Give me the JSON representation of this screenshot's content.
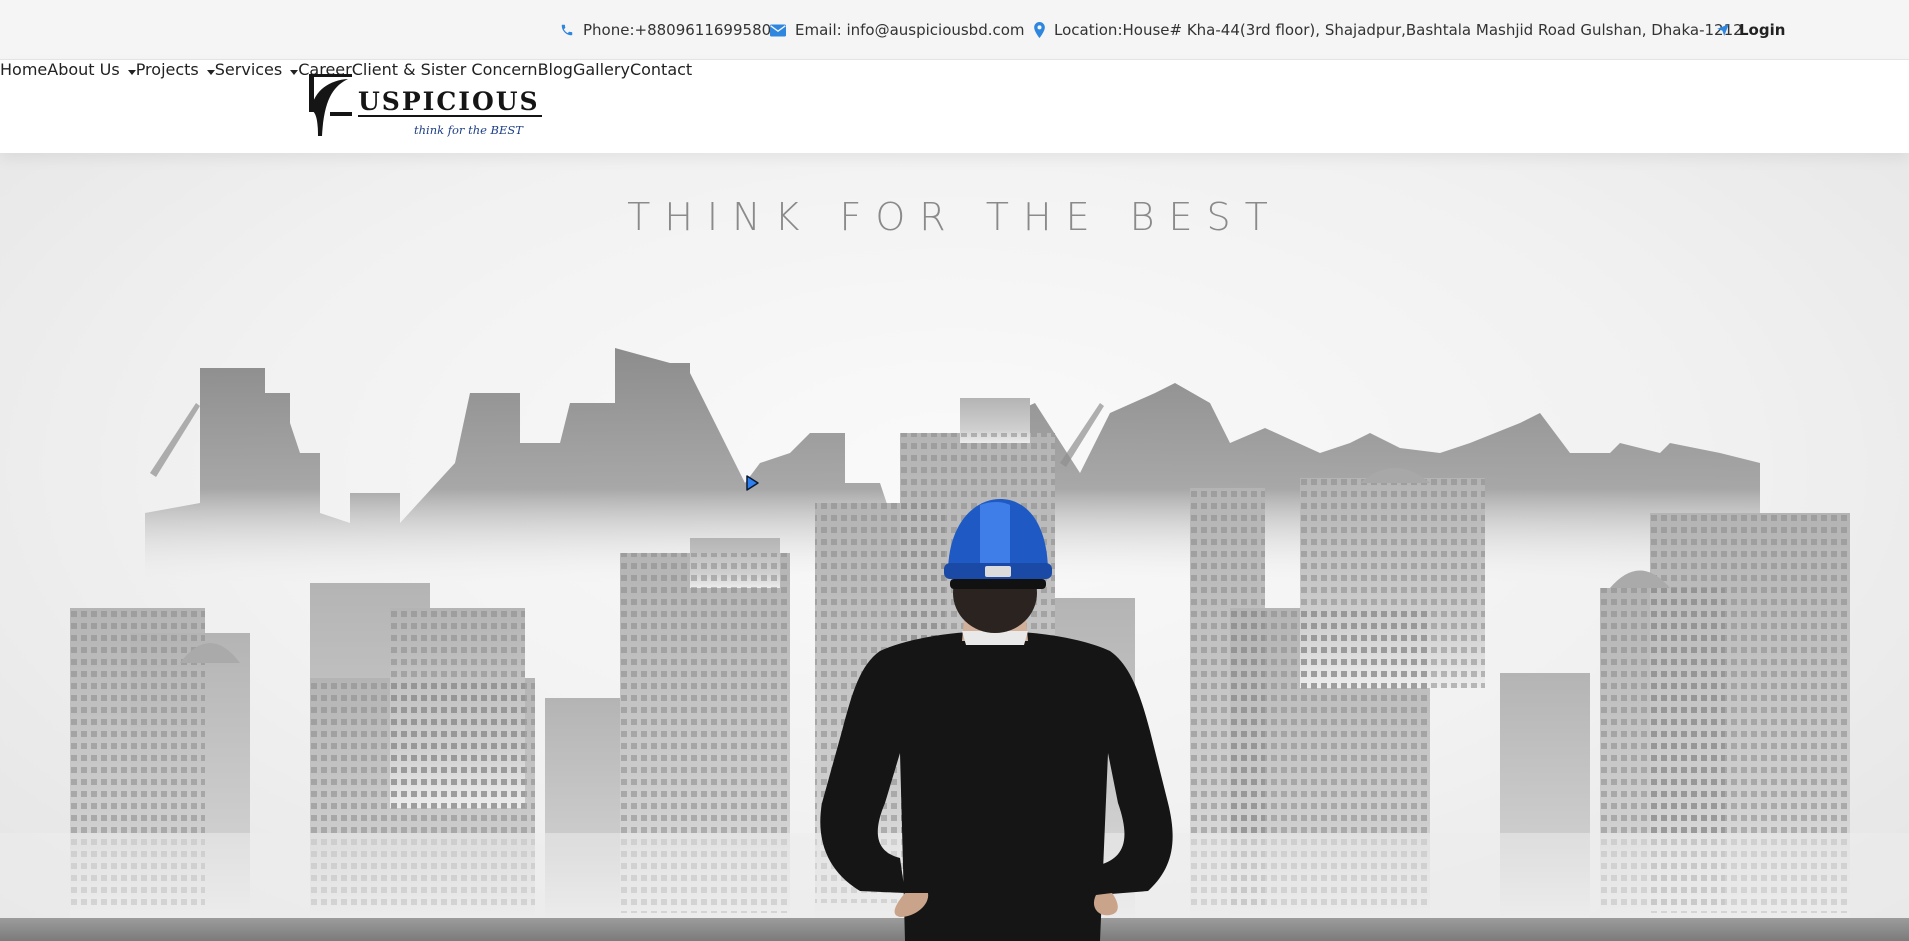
{
  "topbar": {
    "phone": "Phone:+8809611699580",
    "email": "Email: info@auspiciousbd.com",
    "location": "Location:House# Kha-44(3rd floor), Shajadpur,Bashtala Mashjid Road Gulshan, Dhaka-1212",
    "login": "Login",
    "icon_color": "#2e86de"
  },
  "logo": {
    "word": "USPICIOUS",
    "tagline": "think for the BEST"
  },
  "nav": {
    "items": [
      {
        "label": "Home",
        "dropdown": false
      },
      {
        "label": "About Us",
        "dropdown": true
      },
      {
        "label": "Projects",
        "dropdown": true
      },
      {
        "label": "Services",
        "dropdown": true
      },
      {
        "label": "Career",
        "dropdown": false
      },
      {
        "label": "Client & Sister Concern",
        "dropdown": false
      },
      {
        "label": "Blog",
        "dropdown": false
      },
      {
        "label": "Gallery",
        "dropdown": false
      },
      {
        "label": "Contact",
        "dropdown": false
      }
    ]
  },
  "hero": {
    "title": "THINK FOR THE BEST"
  }
}
